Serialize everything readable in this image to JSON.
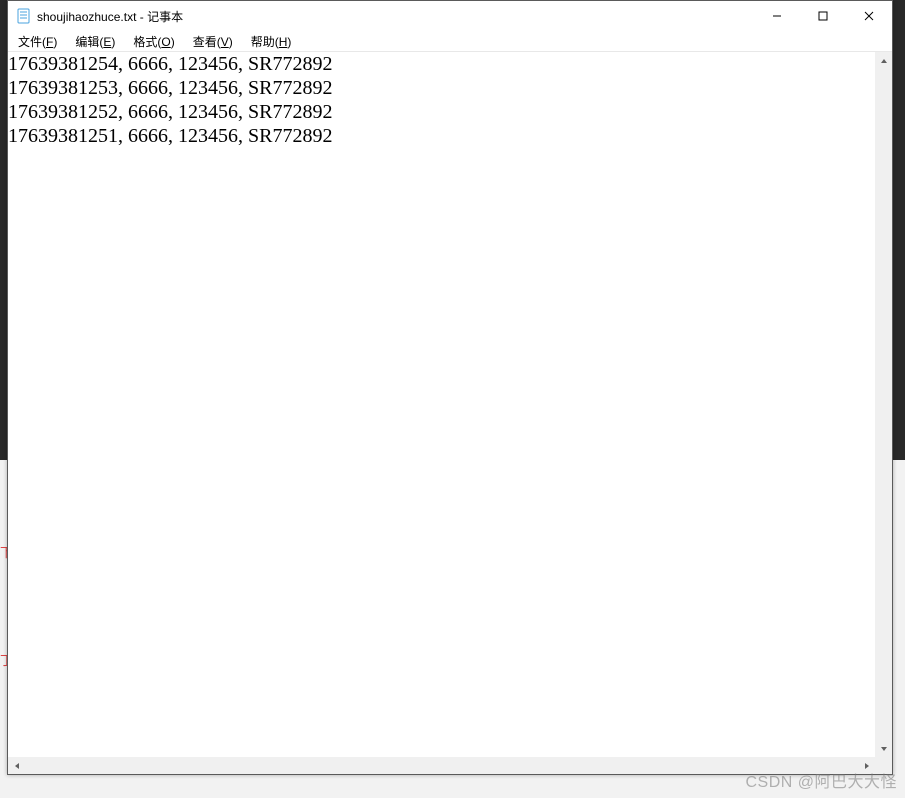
{
  "window": {
    "title": "shoujihaozhuce.txt - 记事本"
  },
  "win_controls": {
    "minimize": "–",
    "maximize": "□",
    "close": "×"
  },
  "menubar": [
    {
      "label_pre": "文件(",
      "accel": "F",
      "label_post": ")"
    },
    {
      "label_pre": "编辑(",
      "accel": "E",
      "label_post": ")"
    },
    {
      "label_pre": "格式(",
      "accel": "O",
      "label_post": ")"
    },
    {
      "label_pre": "查看(",
      "accel": "V",
      "label_post": ")"
    },
    {
      "label_pre": "帮助(",
      "accel": "H",
      "label_post": ")"
    }
  ],
  "content_lines": [
    "17639381254, 6666, 123456, SR772892",
    "17639381253, 6666, 123456, SR772892",
    "17639381252, 6666, 123456, SR772892",
    "17639381251, 6666, 123456, SR772892"
  ],
  "background_hints": {
    "t1": "下",
    "t2": "丁"
  },
  "watermark": "CSDN @阿巴大大怪"
}
